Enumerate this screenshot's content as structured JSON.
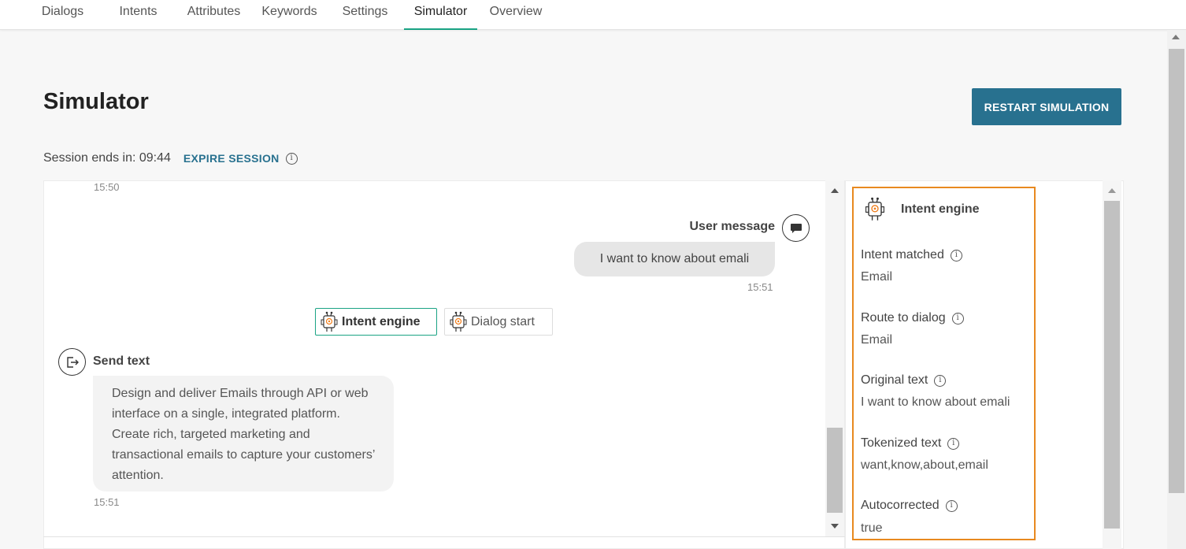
{
  "tabs": [
    {
      "label": "Dialogs"
    },
    {
      "label": "Intents"
    },
    {
      "label": "Attributes"
    },
    {
      "label": "Keywords"
    },
    {
      "label": "Settings"
    },
    {
      "label": "Simulator"
    },
    {
      "label": "Overview"
    }
  ],
  "active_tab": "Simulator",
  "page": {
    "title": "Simulator",
    "restart_label": "RESTART SIMULATION",
    "session_text": "Session ends in: 09:44",
    "expire_label": "EXPIRE SESSION"
  },
  "chat": {
    "top_time": "15:50",
    "user_label": "User message",
    "user_message": "I want to know about emali",
    "user_time": "15:51",
    "chips": [
      {
        "label": "Intent engine"
      },
      {
        "label": "Dialog start"
      }
    ],
    "send_label": "Send text",
    "bot_message": "Design and deliver Emails through API or web interface on a single, integrated platform. Create rich, targeted marketing and transactional emails to capture your customers’ attention.",
    "bot_time": "15:51"
  },
  "inspector": {
    "title": "Intent engine",
    "fields": [
      {
        "label": "Intent matched",
        "value": "Email"
      },
      {
        "label": "Route to dialog",
        "value": "Email"
      },
      {
        "label": "Original text",
        "value": "I want to know about emali"
      },
      {
        "label": "Tokenized text",
        "value": "want,know,about,email"
      },
      {
        "label": "Autocorrected",
        "value": "true"
      }
    ]
  },
  "colors": {
    "accent": "#28718f",
    "active_tab": "#1aa384",
    "highlight": "#e8891f",
    "robot_orange": "#f07d1a"
  },
  "icons": {
    "info": "info-icon",
    "user": "chat-bubble-icon",
    "send": "exit-icon",
    "robot": "robot-icon"
  }
}
